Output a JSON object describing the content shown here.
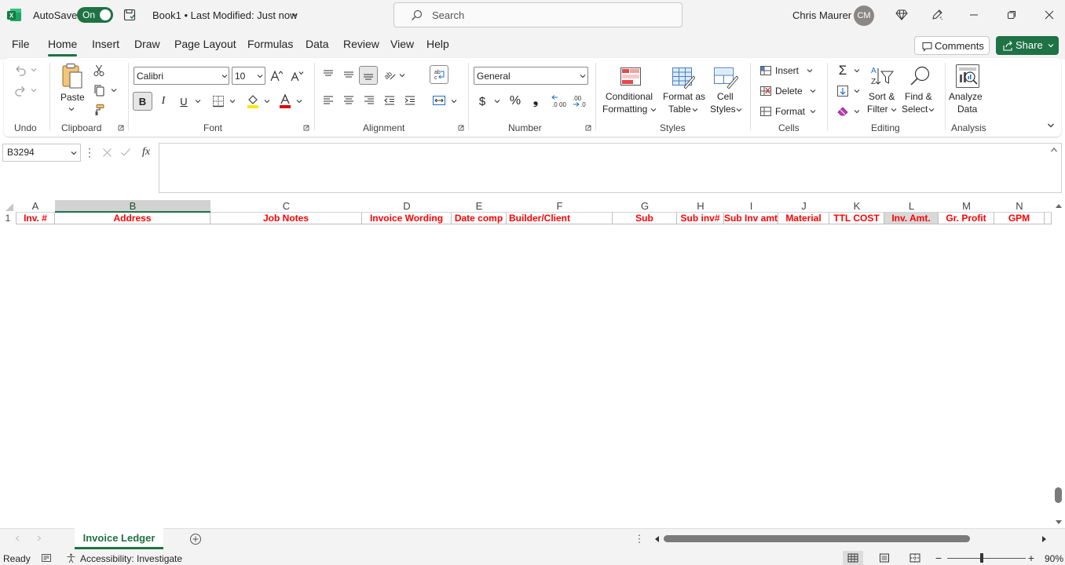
{
  "titlebar": {
    "autosave_label": "AutoSave",
    "autosave_state": "On",
    "doc_title": "Book1 • Last Modified: Just now",
    "search_placeholder": "Search",
    "user_name": "Chris Maurer",
    "user_initials": "CM"
  },
  "menu": {
    "tabs": [
      "File",
      "Home",
      "Insert",
      "Draw",
      "Page Layout",
      "Formulas",
      "Data",
      "Review",
      "View",
      "Help"
    ],
    "active_tab": "Home",
    "comments_label": "Comments",
    "share_label": "Share"
  },
  "ribbon": {
    "undo_group": "Undo",
    "clipboard_group": "Clipboard",
    "paste_label": "Paste",
    "font_group": "Font",
    "font_name": "Calibri",
    "font_size": "10",
    "alignment_group": "Alignment",
    "number_group": "Number",
    "number_format": "General",
    "styles_group": "Styles",
    "conditional_formatting": [
      "Conditional",
      "Formatting"
    ],
    "format_as_table": [
      "Format as",
      "Table"
    ],
    "cell_styles": [
      "Cell",
      "Styles"
    ],
    "cells_group": "Cells",
    "insert_label": "Insert",
    "delete_label": "Delete",
    "format_label": "Format",
    "editing_group": "Editing",
    "sort_filter": [
      "Sort &",
      "Filter"
    ],
    "find_select": [
      "Find &",
      "Select"
    ],
    "analysis_group": "Analysis",
    "analyze_data": [
      "Analyze",
      "Data"
    ]
  },
  "formula_bar": {
    "name_box": "B3294",
    "fx_label": "fx",
    "formula": ""
  },
  "sheet": {
    "columns": [
      "A",
      "B",
      "C",
      "D",
      "E",
      "F",
      "G",
      "H",
      "I",
      "J",
      "K",
      "L",
      "M",
      "N"
    ],
    "row_number": "1",
    "header_cells": [
      "Inv. #",
      "Address",
      "Job Notes",
      "Invoice Wording",
      "Date comp",
      "Builder/Client",
      "Sub",
      "Sub inv#",
      "Sub Inv amt",
      "Material",
      "TTL COST",
      "Inv. Amt.",
      "Gr. Profit",
      "GPM"
    ],
    "selected_column": "B",
    "highlighted_cell_column": "L",
    "tab_name": "Invoice Ledger"
  },
  "status": {
    "ready": "Ready",
    "accessibility": "Accessibility: Investigate",
    "zoom": "90%"
  },
  "colors": {
    "accent": "#1f7244",
    "header_text": "#ff0000",
    "selected_header": "#d2d2d2"
  }
}
